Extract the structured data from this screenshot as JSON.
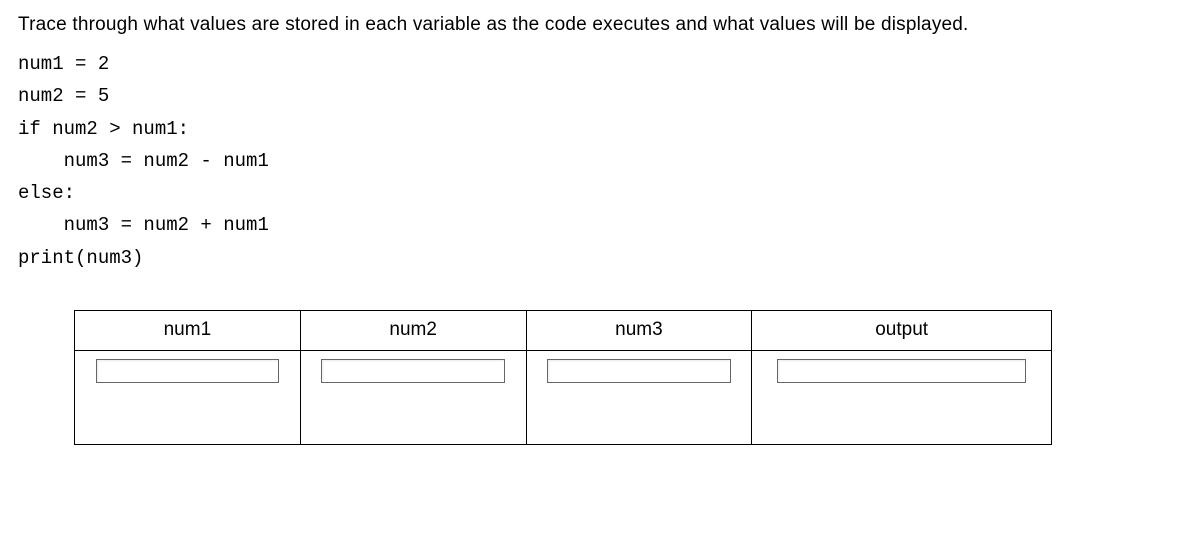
{
  "instruction": "Trace through what values are stored in each variable as the code executes and what values will be displayed.",
  "code_lines": [
    "num1 = 2",
    "num2 = 5",
    "if num2 > num1:",
    "    num3 = num2 - num1",
    "else:",
    "    num3 = num2 + num1",
    "print(num3)"
  ],
  "table": {
    "headers": [
      "num1",
      "num2",
      "num3",
      "output"
    ],
    "inputs": {
      "num1": "",
      "num2": "",
      "num3": "",
      "output": ""
    }
  }
}
